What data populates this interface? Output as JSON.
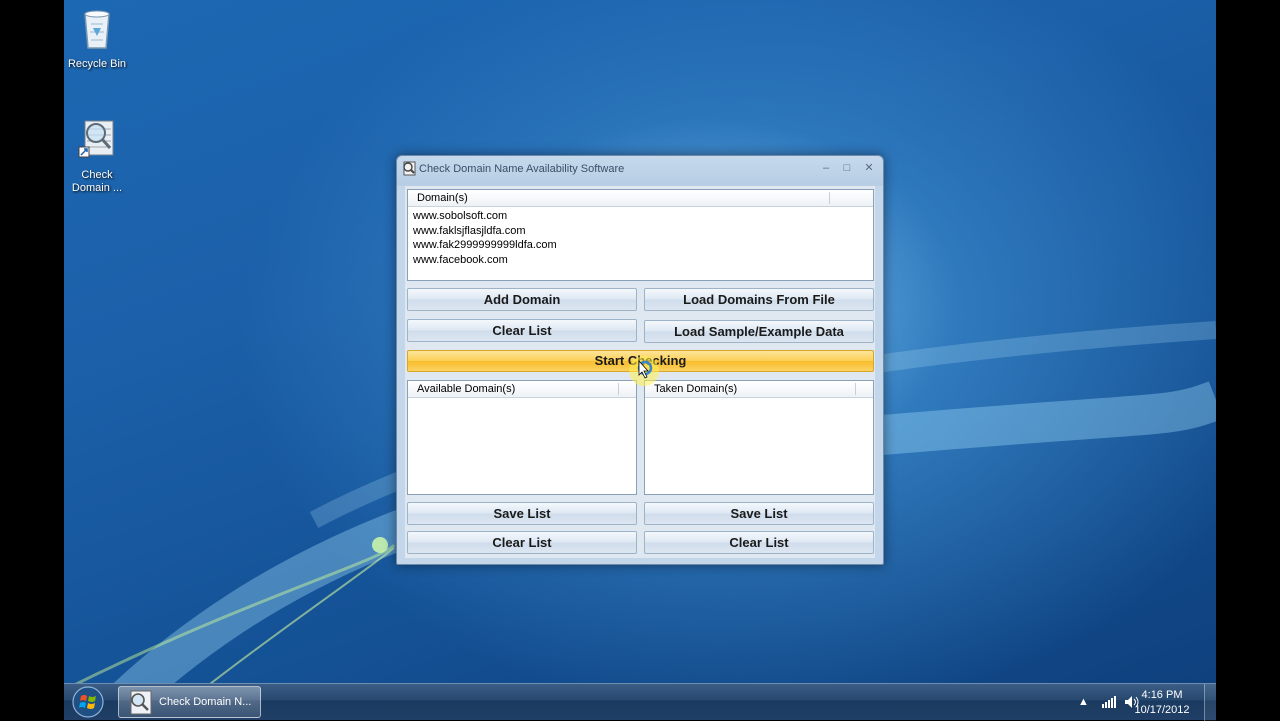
{
  "desktop": {
    "icons": [
      {
        "label": "Recycle Bin",
        "icon": "recycle-bin-icon"
      },
      {
        "label": "Check\nDomain ...",
        "icon": "check-domain-shortcut-icon"
      }
    ]
  },
  "window": {
    "title": "Check Domain Name Availability Software",
    "controls": {
      "minimize": "–",
      "maximize": "□",
      "close": "✕"
    },
    "domains": {
      "header": "Domain(s)",
      "items": [
        "www.sobolsoft.com",
        "www.faklsjflasjldfa.com",
        "www.fak2999999999ldfa.com",
        "www.facebook.com"
      ]
    },
    "buttons": {
      "add_domain": "Add Domain",
      "load_from_file": "Load Domains From File",
      "clear_list": "Clear List",
      "load_sample": "Load Sample/Example Data",
      "start_checking": "Start Checking"
    },
    "available": {
      "header": "Available Domain(s)",
      "save": "Save List",
      "clear": "Clear List"
    },
    "taken": {
      "header": "Taken Domain(s)",
      "save": "Save List",
      "clear": "Clear List"
    }
  },
  "taskbar": {
    "start": "start-orb-icon",
    "task_label": "Check Domain N...",
    "clock_time": "4:16 PM",
    "clock_date": "10/17/2012"
  },
  "colors": {
    "accent_button": "#f8bd2a",
    "desktop": "#1b5fa8",
    "taskbar": "#213f66"
  }
}
